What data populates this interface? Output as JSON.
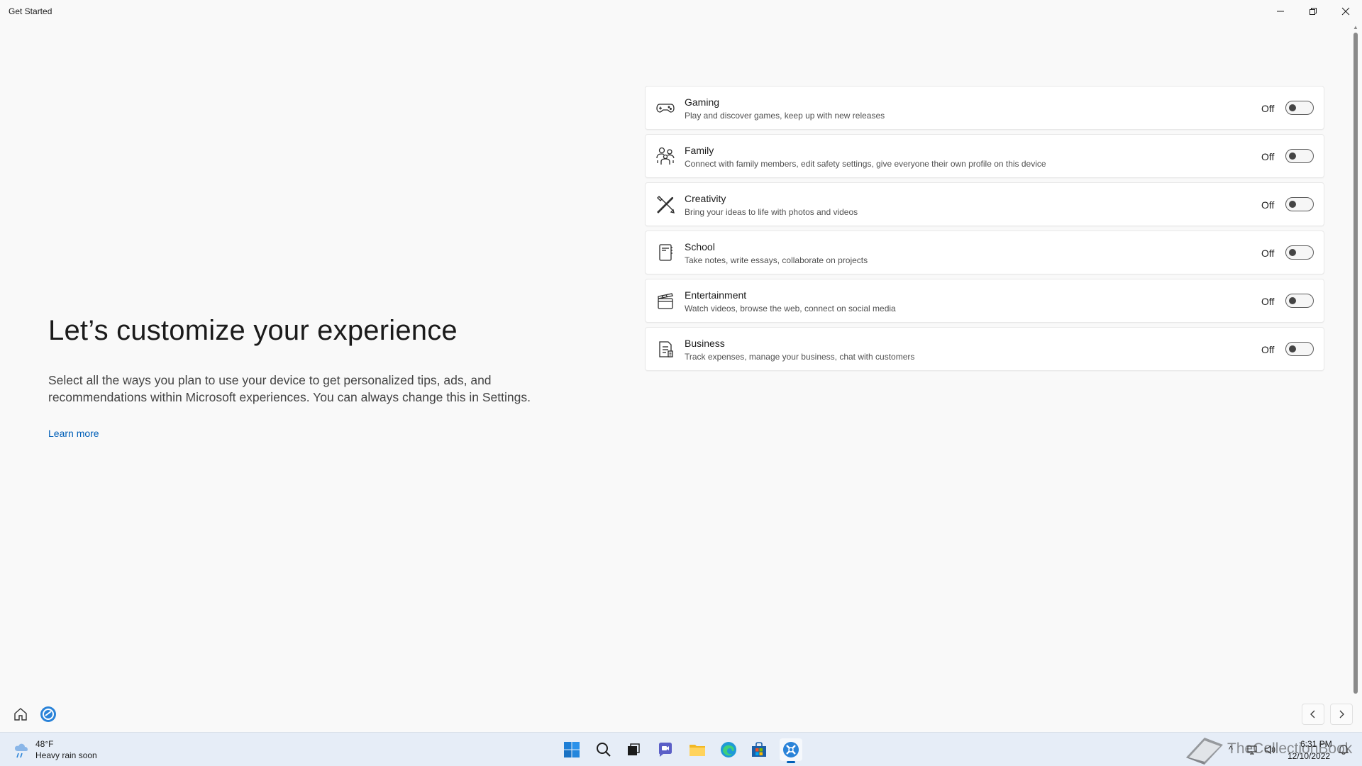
{
  "window": {
    "title": "Get Started"
  },
  "intro": {
    "heading": "Let’s customize your experience",
    "description": "Select all the ways you plan to use your device to get personalized tips, ads, and recommendations within Microsoft experiences. You can always change this in Settings.",
    "learn_more": "Learn more"
  },
  "cards": [
    {
      "icon": "gamepad-icon",
      "title": "Gaming",
      "description": "Play and discover games, keep up with new releases",
      "state": "Off"
    },
    {
      "icon": "family-icon",
      "title": "Family",
      "description": "Connect with family members, edit safety settings, give everyone their own profile on this device",
      "state": "Off"
    },
    {
      "icon": "creativity-icon",
      "title": "Creativity",
      "description": "Bring your ideas to life with photos and videos",
      "state": "Off"
    },
    {
      "icon": "notebook-icon",
      "title": "School",
      "description": "Take notes, write essays, collaborate on projects",
      "state": "Off"
    },
    {
      "icon": "clapperboard-icon",
      "title": "Entertainment",
      "description": "Watch videos, browse the web, connect on social media",
      "state": "Off"
    },
    {
      "icon": "document-icon",
      "title": "Business",
      "description": "Track expenses, manage your business, chat with customers",
      "state": "Off"
    }
  ],
  "taskbar": {
    "weather": {
      "temp": "48°F",
      "condition": "Heavy rain soon"
    },
    "clock": {
      "time": "6:31 PM",
      "date": "12/10/2022"
    },
    "watermark": "TheCollectionBook"
  },
  "colors": {
    "accent": "#005fb8",
    "background": "#f9f9f9",
    "taskbar": "#e6edf7"
  }
}
